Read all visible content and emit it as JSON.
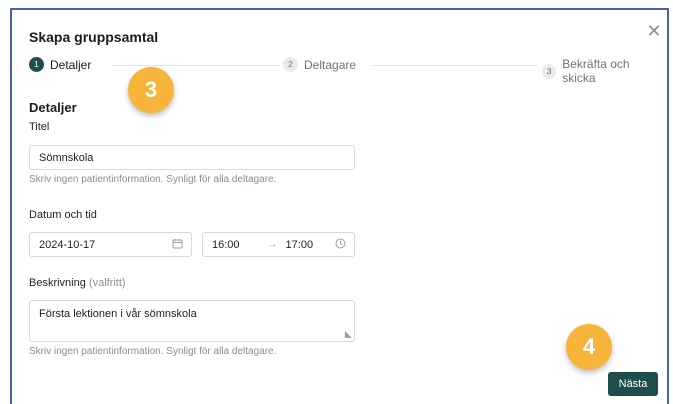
{
  "dialog": {
    "title": "Skapa gruppsamtal",
    "close_icon": "close-icon"
  },
  "stepper": {
    "steps": [
      {
        "num": "1",
        "label": "Detaljer",
        "active": true
      },
      {
        "num": "2",
        "label": "Deltagare",
        "active": false
      },
      {
        "num": "3",
        "label": "Bekräfta och skicka",
        "active": false
      }
    ]
  },
  "annotations": {
    "badge_a": "3",
    "badge_b": "4"
  },
  "form": {
    "section_title": "Detaljer",
    "title_label": "Titel",
    "title_value": "Sömnskola",
    "title_hint": "Skriv ingen patientinformation. Synligt för alla deltagare.",
    "datetime_label": "Datum och tid",
    "date_value": "2024-10-17",
    "date_icon": "calendar-icon",
    "time_start": "16:00",
    "time_arrow": "→",
    "time_end": "17:00",
    "time_icon": "clock-icon",
    "desc_label": "Beskrivning",
    "desc_optional": "(valfritt)",
    "desc_value": "Första lektionen i vår sömnskola",
    "desc_hint": "Skriv ingen patientinformation. Synligt för alla deltagare."
  },
  "footer": {
    "next_label": "Nästa"
  },
  "colors": {
    "primary": "#1e4d4e",
    "badge": "#f6b53a",
    "frame_border": "#4b60b3"
  }
}
